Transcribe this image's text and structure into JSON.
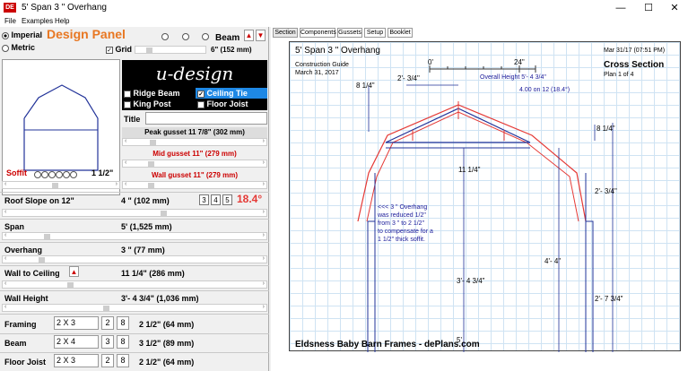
{
  "window": {
    "title": "5'  Span  3 \" Overhang",
    "app_icon": "DE",
    "minimize": "—",
    "maximize": "☐",
    "close": "✕"
  },
  "menu": [
    "File",
    "Examples",
    "Help"
  ],
  "design_panel": {
    "title": "Design Panel",
    "units": {
      "imperial": "Imperial",
      "metric": "Metric"
    },
    "grid_label": "Grid",
    "grid_value": "6\" (152 mm)",
    "beam_label": "Beam",
    "beam_up": "▲",
    "beam_down": "▼"
  },
  "logo": {
    "text": "u-design"
  },
  "options": {
    "ridge_beam": "Ridge Beam",
    "ceiling_tie": "Ceiling Tie",
    "king_post": "King Post",
    "floor_joist": "Floor Joist"
  },
  "title_field": {
    "label": "Title",
    "value": ""
  },
  "gussets": {
    "peak": "Peak gusset 11  7/8\" (302 mm)",
    "mid": "Mid gusset 11\" (279 mm)",
    "wall": "Wall gusset 11\" (279 mm)"
  },
  "soffit": {
    "label": "Soffit",
    "value": "1  1/2\""
  },
  "params": {
    "roof_slope": {
      "label": "Roof Slope on 12\"",
      "value": "4 \" (102 mm)",
      "presets": [
        "3",
        "4",
        "5"
      ],
      "angle": "18.4°"
    },
    "span": {
      "label": "Span",
      "value": "5' (1,525 mm)"
    },
    "overhang": {
      "label": "Overhang",
      "value": "3 \" (77 mm)"
    },
    "wall_to_ceiling": {
      "label": "Wall to Ceiling",
      "value": "11  1/4\" (286 mm)",
      "arrow": "▲"
    },
    "wall_height": {
      "label": "Wall Height",
      "value": "3'- 4  3/4\" (1,036 mm)"
    }
  },
  "lumber": {
    "framing": {
      "label": "Framing",
      "size": "2 X 3",
      "count": "2",
      "ply": "8",
      "value": "2  1/2\" (64 mm)"
    },
    "beam": {
      "label": "Beam",
      "size": "2 X 4",
      "count": "3",
      "ply": "8",
      "value": "3  1/2\" (89 mm)"
    },
    "floor_joist": {
      "label": "Floor Joist",
      "size": "2 X 3",
      "count": "2",
      "ply": "8",
      "value": "2  1/2\" (64 mm)"
    }
  },
  "tabs": [
    "Section",
    "Components",
    "Gussets",
    "Setup",
    "Booklet"
  ],
  "drawing": {
    "heading": "5'  Span  3 \" Overhang",
    "guide": "Construction Guide",
    "date": "March 31, 2017",
    "stamp": "Mar 31/17 (07:51 PM)",
    "view_title": "Cross Section",
    "plan": "Plan 1 of 4",
    "scale_zero": "0'",
    "scale_24": "24\"",
    "overall_height": "Overall Height 5'- 4  3/4\"",
    "slope_note": "4.00 on 12 (18.4°)",
    "dim_top_left": "2'-  3/4\"",
    "dim_left_vert": "8  1/4\"",
    "dim_right_top": "8  1/4\"",
    "dim_center": "11  1/4\"",
    "dim_right_mid": "2'-  3/4\"",
    "dim_wall": "3'- 4  3/4\"",
    "dim_floor": "4'- 4\"",
    "dim_right_low": "2'- 7  3/4\"",
    "dim_span": "5'",
    "note": [
      "<<< 3 \" Overhang",
      "was reduced  1/2\"",
      "from 3 \" to 2  1/2\"",
      "to compensate for a",
      "1  1/2\" thick soffit."
    ],
    "footer": "Eldsness Baby Barn Frames - dePlans.com"
  }
}
